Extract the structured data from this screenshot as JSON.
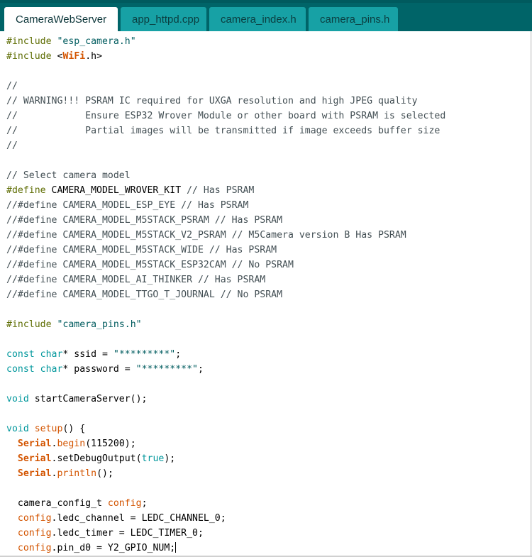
{
  "tabs": [
    {
      "label": "CameraWebServer",
      "active": true
    },
    {
      "label": "app_httpd.cpp",
      "active": false
    },
    {
      "label": "camera_index.h",
      "active": false
    },
    {
      "label": "camera_pins.h",
      "active": false
    }
  ],
  "colors": {
    "tabbar_bg": "#006468",
    "tab_inactive": "#17a1a5",
    "preprocessor": "#5e6d03",
    "string": "#005c5f",
    "comment": "#434f54",
    "keyword": "#00979c",
    "object": "#d35400"
  },
  "code": [
    [
      [
        "pre",
        "#include"
      ],
      [
        "plain",
        " "
      ],
      [
        "str",
        "\"esp_camera.h\""
      ]
    ],
    [
      [
        "pre",
        "#include"
      ],
      [
        "plain",
        " "
      ],
      [
        "plain",
        "<"
      ],
      [
        "bold",
        "WiFi"
      ],
      [
        "plain",
        ".h>"
      ]
    ],
    [],
    [
      [
        "cmt",
        "//"
      ]
    ],
    [
      [
        "cmt",
        "// WARNING!!! PSRAM IC required for UXGA resolution and high JPEG quality"
      ]
    ],
    [
      [
        "cmt",
        "//            Ensure ESP32 Wrover Module or other board with PSRAM is selected"
      ]
    ],
    [
      [
        "cmt",
        "//            Partial images will be transmitted if image exceeds buffer size"
      ]
    ],
    [
      [
        "cmt",
        "//"
      ]
    ],
    [],
    [
      [
        "cmt",
        "// Select camera model"
      ]
    ],
    [
      [
        "pre",
        "#define"
      ],
      [
        "plain",
        " CAMERA_MODEL_WROVER_KIT "
      ],
      [
        "cmt",
        "// Has PSRAM"
      ]
    ],
    [
      [
        "cmt",
        "//#define CAMERA_MODEL_ESP_EYE // Has PSRAM"
      ]
    ],
    [
      [
        "cmt",
        "//#define CAMERA_MODEL_M5STACK_PSRAM // Has PSRAM"
      ]
    ],
    [
      [
        "cmt",
        "//#define CAMERA_MODEL_M5STACK_V2_PSRAM // M5Camera version B Has PSRAM"
      ]
    ],
    [
      [
        "cmt",
        "//#define CAMERA_MODEL_M5STACK_WIDE // Has PSRAM"
      ]
    ],
    [
      [
        "cmt",
        "//#define CAMERA_MODEL_M5STACK_ESP32CAM // No PSRAM"
      ]
    ],
    [
      [
        "cmt",
        "//#define CAMERA_MODEL_AI_THINKER // Has PSRAM"
      ]
    ],
    [
      [
        "cmt",
        "//#define CAMERA_MODEL_TTGO_T_JOURNAL // No PSRAM"
      ]
    ],
    [],
    [
      [
        "pre",
        "#include"
      ],
      [
        "plain",
        " "
      ],
      [
        "str",
        "\"camera_pins.h\""
      ]
    ],
    [],
    [
      [
        "kw",
        "const"
      ],
      [
        "plain",
        " "
      ],
      [
        "kw",
        "char"
      ],
      [
        "plain",
        "* ssid = "
      ],
      [
        "str",
        "\"*********\""
      ],
      [
        "plain",
        ";"
      ]
    ],
    [
      [
        "kw",
        "const"
      ],
      [
        "plain",
        " "
      ],
      [
        "kw",
        "char"
      ],
      [
        "plain",
        "* password = "
      ],
      [
        "str",
        "\"*********\""
      ],
      [
        "plain",
        ";"
      ]
    ],
    [],
    [
      [
        "kw",
        "void"
      ],
      [
        "plain",
        " startCameraServer();"
      ]
    ],
    [],
    [
      [
        "kw",
        "void"
      ],
      [
        "plain",
        " "
      ],
      [
        "obj",
        "setup"
      ],
      [
        "plain",
        "() {"
      ]
    ],
    [
      [
        "plain",
        "  "
      ],
      [
        "bold",
        "Serial"
      ],
      [
        "plain",
        "."
      ],
      [
        "obj",
        "begin"
      ],
      [
        "plain",
        "(115200);"
      ]
    ],
    [
      [
        "plain",
        "  "
      ],
      [
        "bold",
        "Serial"
      ],
      [
        "plain",
        ".setDebugOutput("
      ],
      [
        "lit",
        "true"
      ],
      [
        "plain",
        ");"
      ]
    ],
    [
      [
        "plain",
        "  "
      ],
      [
        "bold",
        "Serial"
      ],
      [
        "plain",
        "."
      ],
      [
        "obj",
        "println"
      ],
      [
        "plain",
        "();"
      ]
    ],
    [],
    [
      [
        "plain",
        "  camera_config_t "
      ],
      [
        "obj",
        "config"
      ],
      [
        "plain",
        ";"
      ]
    ],
    [
      [
        "plain",
        "  "
      ],
      [
        "obj",
        "config"
      ],
      [
        "plain",
        ".ledc_channel = LEDC_CHANNEL_0;"
      ]
    ],
    [
      [
        "plain",
        "  "
      ],
      [
        "obj",
        "config"
      ],
      [
        "plain",
        ".ledc_timer = LEDC_TIMER_0;"
      ]
    ],
    [
      [
        "plain",
        "  "
      ],
      [
        "obj",
        "config"
      ],
      [
        "plain",
        ".pin_d0 = Y2_GPIO_NUM;"
      ],
      [
        "caret",
        ""
      ]
    ]
  ]
}
